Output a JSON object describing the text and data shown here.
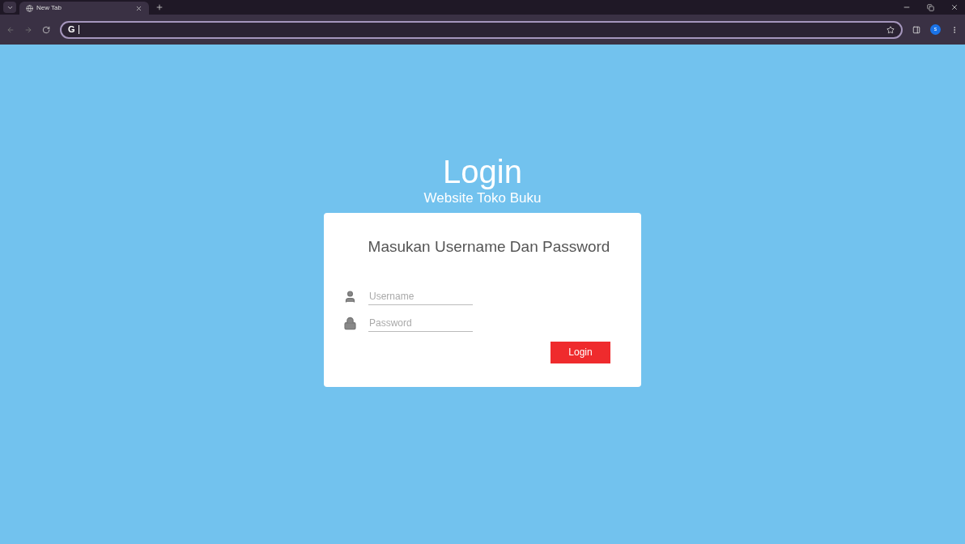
{
  "browser": {
    "tab": {
      "title": "New Tab",
      "selected": true
    },
    "profile_initial": "s",
    "address_bar": {
      "engine_mark": "G"
    }
  },
  "page": {
    "title": "Login",
    "subtitle": "Website Toko Buku"
  },
  "form": {
    "heading": "Masukan Username Dan Password",
    "fields": [
      {
        "kind": "user",
        "placeholder": "Username"
      },
      {
        "kind": "password",
        "placeholder": "Password"
      }
    ],
    "submit": "Login"
  }
}
